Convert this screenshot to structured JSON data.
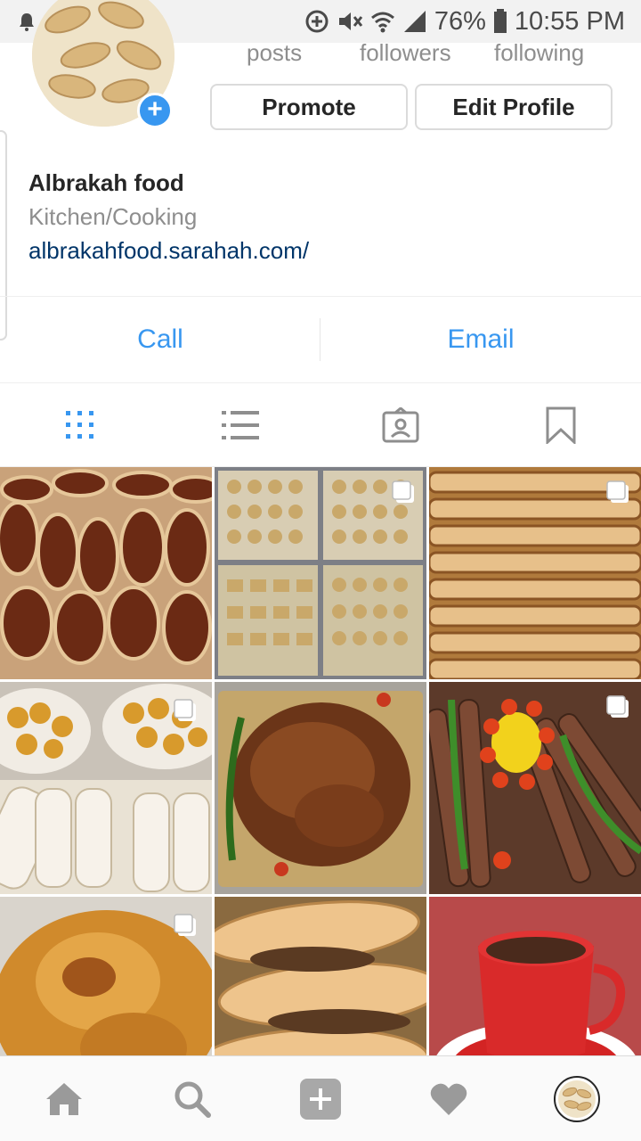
{
  "status_bar": {
    "battery": "76%",
    "time": "10:55 PM"
  },
  "profile": {
    "stats": {
      "posts_label": "posts",
      "followers_label": "followers",
      "following_label": "following"
    },
    "promote_label": "Promote",
    "edit_profile_label": "Edit Profile",
    "name": "Albrakah food",
    "category": "Kitchen/Cooking",
    "website": "albrakahfood.sarahah.com/"
  },
  "contact": {
    "call_label": "Call",
    "email_label": "Email"
  },
  "tabs": [
    {
      "icon": "grid-icon",
      "active": true
    },
    {
      "icon": "list-icon",
      "active": false
    },
    {
      "icon": "tagged-icon",
      "active": false
    },
    {
      "icon": "bookmark-icon",
      "active": false
    }
  ],
  "posts": [
    {
      "subject": "meat flatbreads",
      "multiple": false
    },
    {
      "subject": "cookie trays",
      "multiple": true
    },
    {
      "subject": "rolled pastries",
      "multiple": true
    },
    {
      "subject": "cookies and rolled wraps",
      "multiple": true
    },
    {
      "subject": "roast chicken",
      "multiple": false
    },
    {
      "subject": "kebab skewers",
      "multiple": true
    },
    {
      "subject": "ring cake",
      "multiple": true
    },
    {
      "subject": "filled bread boats",
      "multiple": false
    },
    {
      "subject": "coffee cup",
      "multiple": false
    }
  ],
  "bottom_nav": [
    "home-icon",
    "search-icon",
    "add-post-icon",
    "activity-heart-icon",
    "profile-avatar-icon"
  ],
  "colors": {
    "accent": "#3897f0",
    "link": "#003569",
    "muted": "#8e8e8e",
    "border": "#dbdbdb"
  }
}
